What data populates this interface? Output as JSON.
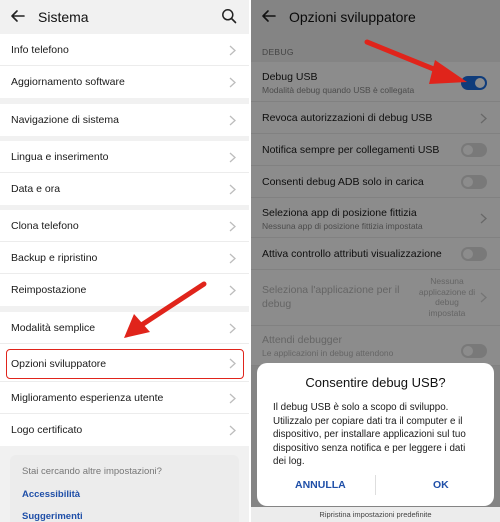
{
  "left": {
    "title": "Sistema",
    "groups": [
      [
        "Info telefono",
        "Aggiornamento software"
      ],
      [
        "Navigazione di sistema"
      ],
      [
        "Lingua e inserimento",
        "Data e ora"
      ],
      [
        "Clona telefono",
        "Backup e ripristino",
        "Reimpostazione"
      ],
      [
        "Modalità semplice",
        "Opzioni sviluppatore",
        "Miglioramento esperienza utente",
        "Logo certificato"
      ]
    ],
    "search_card": {
      "question": "Stai cercando altre impostazioni?",
      "links": [
        "Accessibilità",
        "Suggerimenti"
      ]
    }
  },
  "right": {
    "title": "Opzioni sviluppatore",
    "section": "DEBUG",
    "rows": [
      {
        "label": "Debug USB",
        "sub": "Modalità debug quando USB è collegata",
        "control": "toggle",
        "on": true
      },
      {
        "label": "Revoca autorizzazioni di debug USB",
        "control": "chevron"
      },
      {
        "label": "Notifica sempre per collegamenti USB",
        "control": "toggle",
        "on": false
      },
      {
        "label": "Consenti debug ADB solo in carica",
        "control": "toggle",
        "on": false
      },
      {
        "label": "Seleziona app di posizione fittizia",
        "sub": "Nessuna app di posizione fittizia impostata",
        "control": "chevron"
      },
      {
        "label": "Attiva controllo attributi visualizzazione",
        "control": "toggle",
        "on": false
      },
      {
        "label": "Seleziona l'applicazione per il",
        "label2": "debug",
        "side": "Nessuna applicazione di debug impostata",
        "control": "chevron",
        "disabled": true
      },
      {
        "label": "Attendi debugger",
        "sub": "Le applicazioni in debug attendono",
        "control": "toggle",
        "on": false,
        "disabled": true
      }
    ],
    "dialog": {
      "title": "Consentire debug USB?",
      "body": "Il debug USB è solo a scopo di sviluppo. Utilizzalo per copiare dati tra il computer e il dispositivo, per installare applicazioni sul tuo dispositivo senza notifica e per leggere i dati dei log.",
      "cancel": "ANNULLA",
      "ok": "OK"
    },
    "bottom_text": "Ripristina impostazioni predefinite"
  },
  "colors": {
    "accent": "#1d6de0",
    "link": "#1f4fa8",
    "highlight": "#e0241b",
    "arrow": "#e0241b"
  }
}
